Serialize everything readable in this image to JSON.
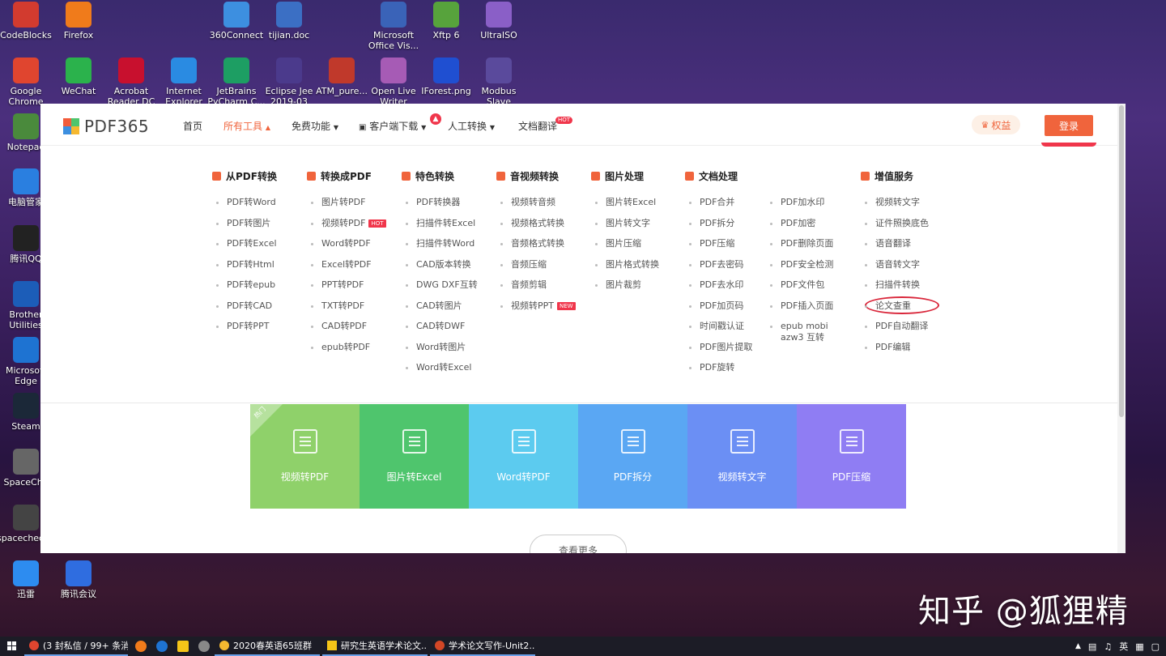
{
  "desktop": {
    "icons": [
      {
        "label": "CodeBlocks",
        "color": "#d23b2f"
      },
      {
        "label": "Firefox",
        "color": "#f07b1b"
      },
      {
        "label": "360Connect",
        "color": "#3d8fe0"
      },
      {
        "label": "tijian.doc",
        "color": "#3b6fc4"
      },
      {
        "label": "Microsoft Office Vis...",
        "color": "#3a63b8"
      },
      {
        "label": "Xftp 6",
        "color": "#57a33c"
      },
      {
        "label": "UltraISO",
        "color": "#8a5fc7"
      },
      {
        "label": "Google Chrome",
        "color": "#e0452f"
      },
      {
        "label": "WeChat",
        "color": "#2bb24c"
      },
      {
        "label": "Acrobat Reader DC",
        "color": "#c8102e"
      },
      {
        "label": "Internet Explorer",
        "color": "#2a8be2"
      },
      {
        "label": "JetBrains PyCharm C...",
        "color": "#1d9e63"
      },
      {
        "label": "Eclipse Jee 2019-03",
        "color": "#4b3a8c"
      },
      {
        "label": "ATM_pure...",
        "color": "#c0392b"
      },
      {
        "label": "Open Live Writer",
        "color": "#a65bb5"
      },
      {
        "label": "IForest.png",
        "color": "#1f4fd1"
      },
      {
        "label": "Modbus Slave",
        "color": "#5a4a9c"
      },
      {
        "label": "Notepad",
        "color": "#4a8a3c"
      },
      {
        "label": "电脑管家",
        "color": "#2a7fe0"
      },
      {
        "label": "腾讯QQ",
        "color": "#222222"
      },
      {
        "label": "Brother Utilities",
        "color": "#1c5db8"
      },
      {
        "label": "Microsoft Edge",
        "color": "#1e73d2"
      },
      {
        "label": "Steam",
        "color": "#1b2838"
      },
      {
        "label": "SpaceChe",
        "color": "#666666"
      },
      {
        "label": "spacechecker",
        "color": "#444444"
      },
      {
        "label": "迅雷",
        "color": "#2d8cf0"
      },
      {
        "label": "腾讯会议",
        "color": "#2f6de0"
      }
    ],
    "watermark": "知乎 @狐狸精"
  },
  "nav": {
    "brand": "PDF365",
    "items": [
      "首页",
      "所有工具",
      "免费功能",
      "客户端下载",
      "人工转换",
      "文档翻译"
    ],
    "hot": "HOT",
    "perks": "权益",
    "login": "登录"
  },
  "menu": {
    "columns": [
      {
        "title": "从PDF转换",
        "items": [
          "PDF转Word",
          "PDF转图片",
          "PDF转Excel",
          "PDF转Html",
          "PDF转epub",
          "PDF转CAD",
          "PDF转PPT"
        ]
      },
      {
        "title": "转换成PDF",
        "items": [
          "图片转PDF",
          "视频转PDF",
          "Word转PDF",
          "Excel转PDF",
          "PPT转PDF",
          "TXT转PDF",
          "CAD转PDF",
          "epub转PDF"
        ]
      },
      {
        "title": "特色转换",
        "items": [
          "PDF转换器",
          "扫描件转Excel",
          "扫描件转Word",
          "CAD版本转换",
          "DWG DXF互转",
          "CAD转图片",
          "CAD转DWF",
          "Word转图片",
          "Word转Excel"
        ]
      },
      {
        "title": "音视频转换",
        "items": [
          "视频转音频",
          "视频格式转换",
          "音频格式转换",
          "音频压缩",
          "音频剪辑",
          "视频转PPT"
        ]
      },
      {
        "title": "图片处理",
        "items": [
          "图片转Excel",
          "图片转文字",
          "图片压缩",
          "图片格式转换",
          "图片裁剪"
        ]
      },
      {
        "title": "文档处理",
        "items": [
          "PDF合并",
          "PDF拆分",
          "PDF压缩",
          "PDF去密码",
          "PDF去水印",
          "PDF加页码",
          "时间戳认证",
          "PDF图片提取",
          "PDF旋转"
        ]
      },
      {
        "title": "",
        "items": [
          "PDF加水印",
          "PDF加密",
          "PDF删除页面",
          "PDF安全检测",
          "PDF文件包",
          "PDF插入页面",
          "epub mobi azw3 互转"
        ]
      },
      {
        "title": "增值服务",
        "items": [
          "视频转文字",
          "证件照换底色",
          "语音翻译",
          "语音转文字",
          "扫描件转换",
          "论文查重",
          "PDF自动翻译",
          "PDF编辑"
        ]
      }
    ],
    "tag_hot": "HOT",
    "tag_new": "NEW"
  },
  "tiles": [
    {
      "label": "视频转PDF",
      "color": "#8fd16a"
    },
    {
      "label": "图片转Excel",
      "color": "#4fc56d"
    },
    {
      "label": "Word转PDF",
      "color": "#5ccbef"
    },
    {
      "label": "PDF拆分",
      "color": "#5aa7f3"
    },
    {
      "label": "视频转文字",
      "color": "#6b8ff4"
    },
    {
      "label": "PDF压缩",
      "color": "#8f7df3"
    }
  ],
  "ribbon": "热门",
  "more": "查看更多",
  "taskbar": {
    "apps": [
      "(3 封私信 / 99+ 条消...",
      "2020春英语65班群",
      "研究生英语学术论文...",
      "学术论文写作-Unit2...."
    ],
    "tray": [
      "英"
    ]
  }
}
